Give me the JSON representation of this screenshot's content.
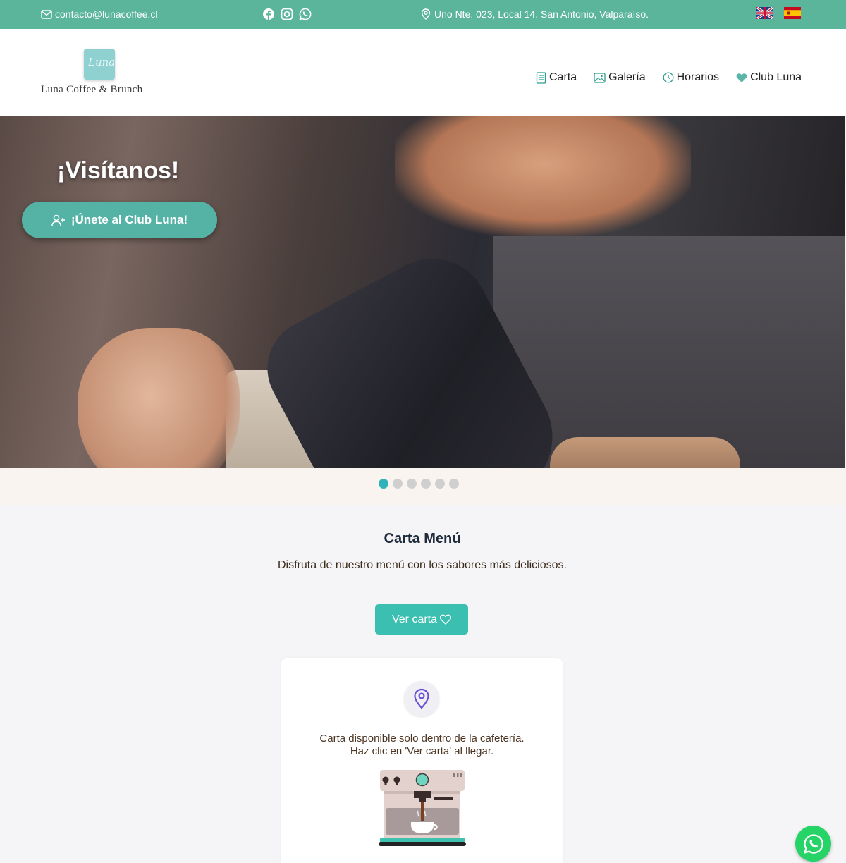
{
  "topbar": {
    "email": "contacto@lunacoffee.cl",
    "address": "Uno Nte. 023, Local 14. San Antonio, Valparaíso.",
    "social_icons": [
      "facebook-icon",
      "instagram-icon",
      "whatsapp-icon"
    ],
    "languages": [
      "English",
      "Español"
    ]
  },
  "header": {
    "logo_script": "Luna",
    "brand": "Luna Coffee & Brunch",
    "nav": [
      {
        "label": "Carta",
        "icon": "menu-document-icon"
      },
      {
        "label": "Galería",
        "icon": "image-icon"
      },
      {
        "label": "Horarios",
        "icon": "clock-icon"
      },
      {
        "label": "Club Luna",
        "icon": "heart-icon"
      }
    ]
  },
  "hero": {
    "title": "¡Visítanos!",
    "cta": "¡Únete al Club Luna!",
    "slides": 6,
    "active_slide": 1
  },
  "menu_section": {
    "title": "Carta Menú",
    "subtitle": "Disfruta de nuestro menú con los sabores más deliciosos.",
    "button": "Ver carta",
    "notice_line1": "Carta disponible solo dentro de la cafetería.",
    "notice_line2": "Haz clic en 'Ver carta' al llegar."
  },
  "colors": {
    "topbar": "#5bb59b",
    "accent": "#3bbfb0",
    "dot_active": "#2fb3b8",
    "whatsapp": "#25d366"
  }
}
